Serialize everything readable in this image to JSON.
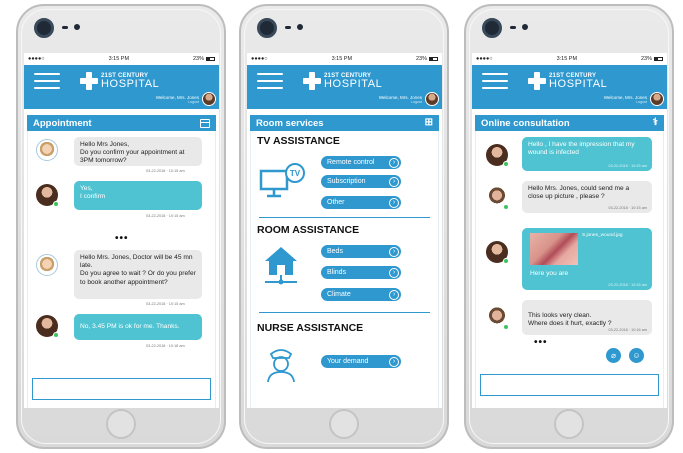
{
  "status": {
    "time": "3:15 PM",
    "battery": "23%",
    "signal": "●●●●○"
  },
  "header": {
    "brand_line1": "21ST CENTURY",
    "brand_line2": "HOSPITAL",
    "welcome": "Welcome, Mrs. Jones",
    "welcome_sub": "Logout"
  },
  "screen1": {
    "title": "Appointment",
    "messages": [
      {
        "text": "Hello Mrs Jones,\nDo you confirm your appointment at 3PM tomorrow?",
        "time": "03-22-2018 · 10:15 am"
      },
      {
        "text": "Yes,\nI confirm",
        "time": "03-22-2018 · 10:15 am"
      },
      {
        "text": "Hello Mrs. Jones, Doctor will be 45 mn late.\nDo you agree to wait ? Or do you prefer to book another appointment?",
        "time": "03-22-2018 · 10:15 am"
      },
      {
        "text": "No, 3.45 PM is ok for me. Thanks.",
        "time": "03-22-2018 · 10:18 am"
      }
    ],
    "more": "•••"
  },
  "screen2": {
    "title": "Room services",
    "sections": [
      {
        "heading": "TV ASSISTANCE",
        "buttons": [
          "Remote control",
          "Subscription",
          "Other"
        ]
      },
      {
        "heading": "ROOM ASSISTANCE",
        "buttons": [
          "Beds",
          "Blinds",
          "Climate"
        ]
      },
      {
        "heading": "NURSE ASSISTANCE",
        "buttons": [
          "Your demand"
        ]
      }
    ]
  },
  "screen3": {
    "title": "Online consultation",
    "messages": [
      {
        "text": "Hello , I have the impression that my wound is infected",
        "time": "03-22-2018 · 10:15 am"
      },
      {
        "text": "Hello Mrs. Jones, could send me a close up picture , please ?",
        "time": "03-22-2018 · 10:15 am"
      },
      {
        "file": "S.jones_wound.jpg",
        "text": "Here you are",
        "time": "03-22-2018 · 10:15 am"
      },
      {
        "text": "This looks very clean.\nWhere does it hurt, exactly ?",
        "time": "03-22-2018 · 10:16 am"
      }
    ],
    "more": "•••"
  },
  "colors": {
    "primary": "#2e98cf",
    "bubble_blue": "#4fc3d1",
    "bubble_grey": "#e9e9e9",
    "online": "#3cc35e"
  }
}
